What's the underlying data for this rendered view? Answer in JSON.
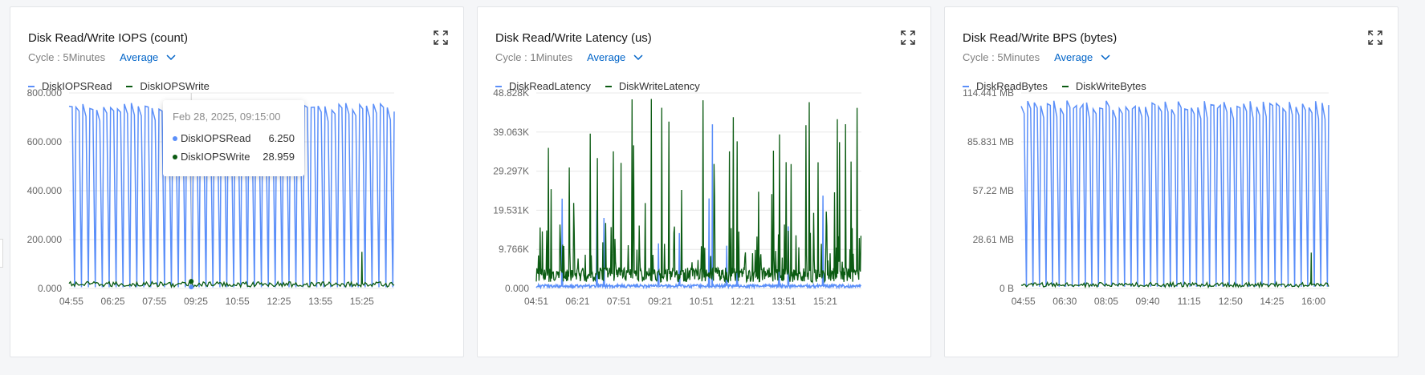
{
  "colors": {
    "read": "#5b8ff9",
    "write": "#0b5b12",
    "accent": "#0064c8",
    "grid": "#e8e8e8",
    "axis_text": "#666666"
  },
  "icons": {
    "expand": "expand-icon",
    "chevron": "chevron-down-icon"
  },
  "cards": [
    {
      "title": "Disk Read/Write IOPS (count)",
      "cycle": "Cycle : 5Minutes",
      "aggregation": "Average",
      "legend": [
        "DiskIOPSRead",
        "DiskIOPSWrite"
      ],
      "tooltip": {
        "time": "Feb 28, 2025, 09:15:00",
        "rows": [
          {
            "name": "DiskIOPSRead",
            "value": "6.250"
          },
          {
            "name": "DiskIOPSWrite",
            "value": "28.959"
          }
        ]
      }
    },
    {
      "title": "Disk Read/Write Latency (us)",
      "cycle": "Cycle : 1Minutes",
      "aggregation": "Average",
      "legend": [
        "DiskReadLatency",
        "DiskWriteLatency"
      ]
    },
    {
      "title": "Disk Read/Write BPS (bytes)",
      "cycle": "Cycle : 5Minutes",
      "aggregation": "Average",
      "legend": [
        "DiskReadBytes",
        "DiskWriteBytes"
      ]
    }
  ],
  "chart_data": [
    {
      "type": "line",
      "ylim": [
        0,
        800
      ],
      "y_ticks": [
        "800.000",
        "600.000",
        "400.000",
        "200.000",
        "0.000"
      ],
      "x_ticks": [
        "04:55",
        "06:25",
        "07:55",
        "09:25",
        "10:55",
        "12:25",
        "13:55",
        "15:25"
      ],
      "x_range": [
        "04:50",
        "16:35"
      ],
      "series": [
        {
          "name": "DiskIOPSRead",
          "pattern": "periodic-spikes",
          "period_minutes": 15,
          "peak": 760,
          "baseline": 5
        },
        {
          "name": "DiskIOPSWrite",
          "pattern": "low-noise",
          "mean": 20,
          "max": 150,
          "max_at": "15:25"
        }
      ],
      "highlight": {
        "x": "09:15",
        "DiskIOPSRead": 6.25,
        "DiskIOPSWrite": 28.959
      }
    },
    {
      "type": "line",
      "ylim": [
        0,
        48828
      ],
      "y_ticks": [
        "48.828K",
        "39.063K",
        "29.297K",
        "19.531K",
        "9.766K",
        "0.000"
      ],
      "x_ticks": [
        "04:51",
        "06:21",
        "07:51",
        "09:21",
        "10:51",
        "12:21",
        "13:51",
        "15:21"
      ],
      "x_range": [
        "04:51",
        "16:40"
      ],
      "series": [
        {
          "name": "DiskReadLatency",
          "pattern": "low-noise",
          "mean": 700,
          "max": 41000,
          "max_at": "11:15"
        },
        {
          "name": "DiskWriteLatency",
          "pattern": "noisy-spikes",
          "mean": 4000,
          "max": 48000
        }
      ]
    },
    {
      "type": "line",
      "ylim": [
        0,
        114.441
      ],
      "y_unit": "MB",
      "y_ticks": [
        "114.441 MB",
        "85.831 MB",
        "57.22 MB",
        "28.61 MB",
        "0 B"
      ],
      "x_ticks": [
        "04:55",
        "06:30",
        "08:05",
        "09:40",
        "11:15",
        "12:50",
        "14:25",
        "16:00"
      ],
      "x_range": [
        "04:50",
        "16:35"
      ],
      "series": [
        {
          "name": "DiskReadBytes",
          "pattern": "periodic-spikes",
          "period_minutes": 15,
          "peak": 110,
          "baseline": 1
        },
        {
          "name": "DiskWriteBytes",
          "pattern": "low-noise",
          "mean": 2.5,
          "max": 21,
          "max_at": "15:55"
        }
      ]
    }
  ]
}
